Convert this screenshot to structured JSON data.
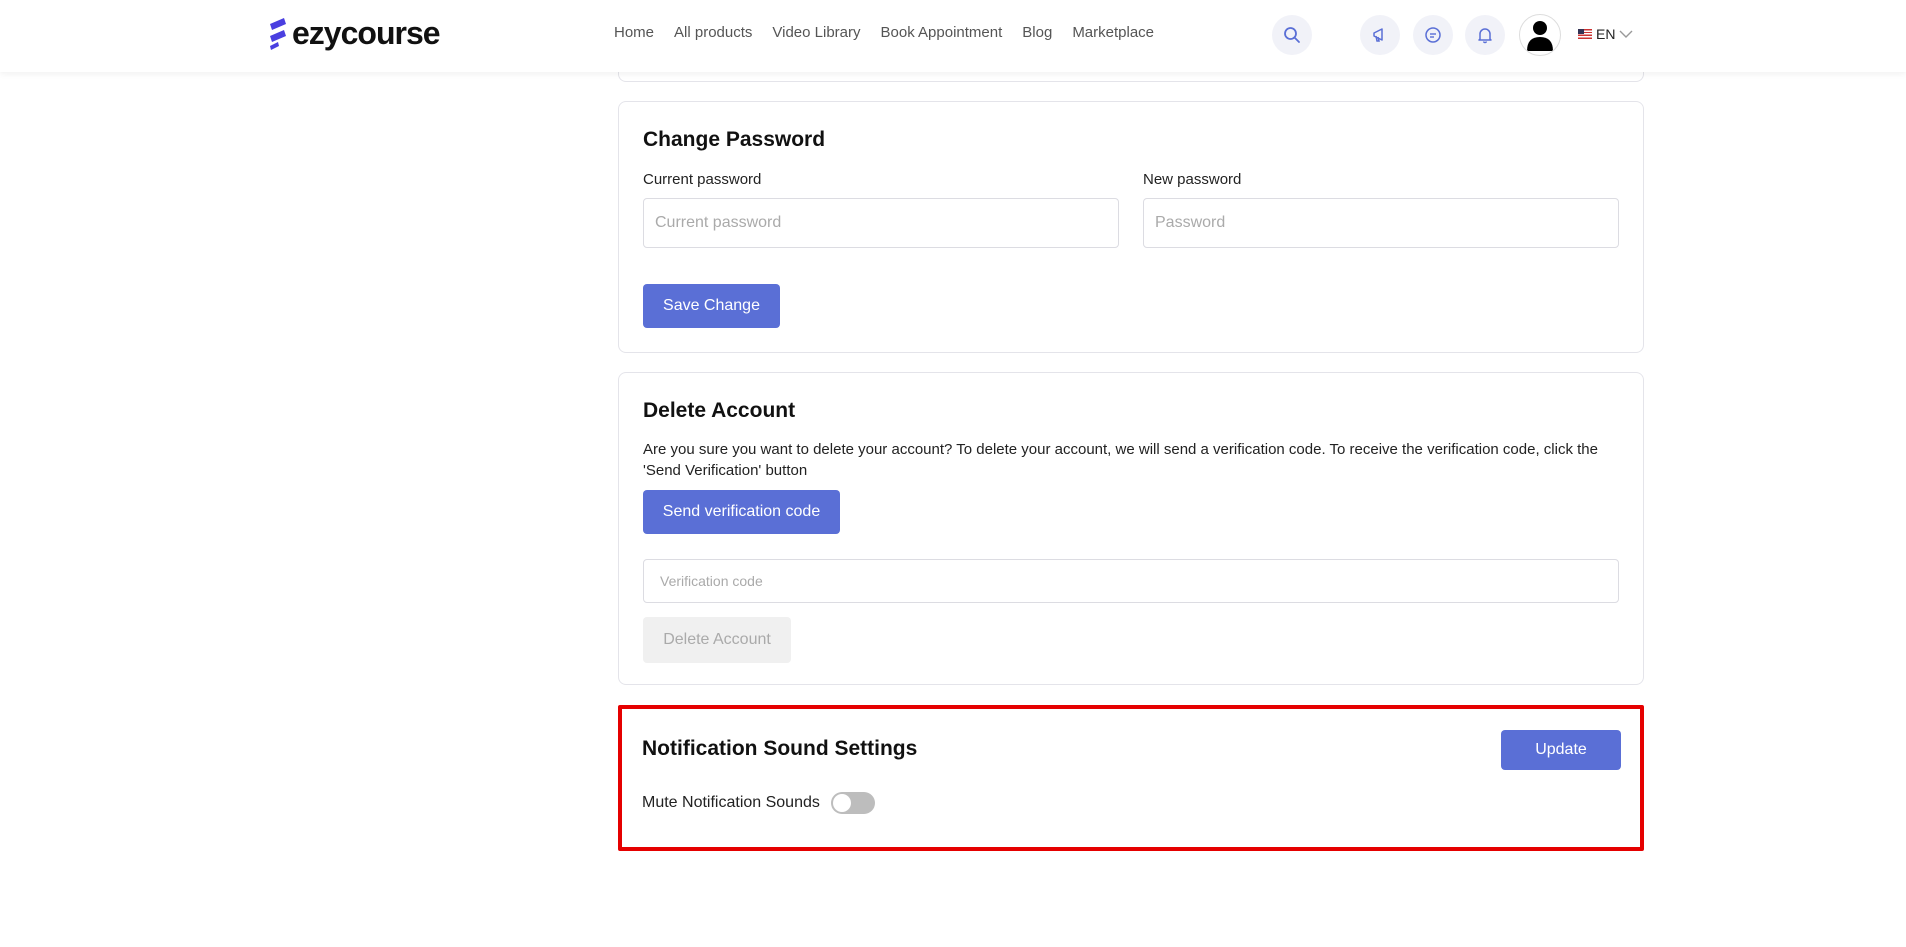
{
  "header": {
    "logo_text": "ezycourse",
    "nav": [
      "Home",
      "All products",
      "Video Library",
      "Book Appointment",
      "Blog",
      "Marketplace"
    ],
    "language": "EN",
    "icons": [
      "search-icon",
      "megaphone-icon",
      "chat-icon",
      "bell-icon",
      "avatar",
      "flag-us-icon",
      "chevron-down-icon"
    ]
  },
  "change_password": {
    "title": "Change Password",
    "current_label": "Current password",
    "current_placeholder": "Current password",
    "new_label": "New password",
    "new_placeholder": "Password",
    "save_label": "Save Change"
  },
  "delete_account": {
    "title": "Delete Account",
    "description": "Are you sure you want to delete your account? To delete your account, we will send a verification code. To receive the verification code, click the 'Send Verification' button",
    "send_label": "Send verification code",
    "code_placeholder": "Verification code",
    "delete_label": "Delete Account"
  },
  "notification_sound": {
    "title": "Notification Sound Settings",
    "update_label": "Update",
    "mute_label": "Mute Notification Sounds",
    "mute_on": false
  },
  "colors": {
    "accent": "#5a6fd6",
    "highlight": "#e50000"
  }
}
